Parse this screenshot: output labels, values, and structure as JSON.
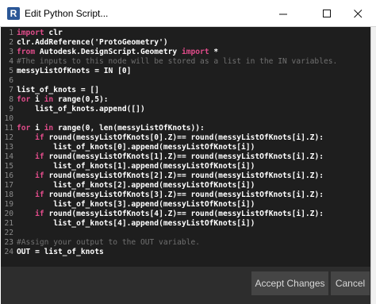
{
  "window": {
    "title": "Edit Python Script...",
    "app_icon_letter": "R",
    "controls": {
      "minimize": "minimize",
      "maximize": "maximize",
      "close": "close"
    }
  },
  "editor": {
    "lines": [
      {
        "n": "1",
        "segs": [
          [
            "kw",
            "import"
          ],
          [
            "tx",
            " clr"
          ]
        ]
      },
      {
        "n": "2",
        "segs": [
          [
            "tx",
            "clr.AddReference("
          ],
          [
            "st",
            "'ProtoGeometry'"
          ],
          [
            "tx",
            ")"
          ]
        ]
      },
      {
        "n": "3",
        "segs": [
          [
            "kw",
            "from"
          ],
          [
            "tx",
            " Autodesk.DesignScript.Geometry "
          ],
          [
            "kw",
            "import"
          ],
          [
            "tx",
            " *"
          ]
        ]
      },
      {
        "n": "4",
        "segs": [
          [
            "cm",
            "#The inputs to this node will be stored as a list in the IN variables."
          ]
        ]
      },
      {
        "n": "5",
        "segs": [
          [
            "tx",
            "messyListOfKnots = IN ["
          ],
          [
            "nu",
            "0"
          ],
          [
            "tx",
            "]"
          ]
        ]
      },
      {
        "n": "6",
        "segs": []
      },
      {
        "n": "7",
        "segs": [
          [
            "tx",
            "list_of_knots = []"
          ]
        ]
      },
      {
        "n": "8",
        "segs": [
          [
            "kw",
            "for"
          ],
          [
            "tx",
            " i "
          ],
          [
            "kw",
            "in"
          ],
          [
            "tx",
            " range("
          ],
          [
            "nu",
            "0"
          ],
          [
            "tx",
            ","
          ],
          [
            "nu",
            "5"
          ],
          [
            "tx",
            "):"
          ]
        ]
      },
      {
        "n": "9",
        "segs": [
          [
            "tx",
            "    list_of_knots.append([])"
          ]
        ]
      },
      {
        "n": "10",
        "segs": []
      },
      {
        "n": "11",
        "segs": [
          [
            "kw",
            "for"
          ],
          [
            "tx",
            " i "
          ],
          [
            "kw",
            "in"
          ],
          [
            "tx",
            " range("
          ],
          [
            "nu",
            "0"
          ],
          [
            "tx",
            ", len(messyListOfKnots)):"
          ]
        ]
      },
      {
        "n": "12",
        "segs": [
          [
            "tx",
            "    "
          ],
          [
            "kw",
            "if"
          ],
          [
            "tx",
            " round(messyListOfKnots["
          ],
          [
            "nu",
            "0"
          ],
          [
            "tx",
            "].Z)== round(messyListOfKnots[i].Z):"
          ]
        ]
      },
      {
        "n": "13",
        "segs": [
          [
            "tx",
            "        list_of_knots["
          ],
          [
            "nu",
            "0"
          ],
          [
            "tx",
            "].append(messyListOfKnots[i])"
          ]
        ]
      },
      {
        "n": "14",
        "segs": [
          [
            "tx",
            "    "
          ],
          [
            "kw",
            "if"
          ],
          [
            "tx",
            " round(messyListOfKnots["
          ],
          [
            "nu",
            "1"
          ],
          [
            "tx",
            "].Z)== round(messyListOfKnots[i].Z):"
          ]
        ]
      },
      {
        "n": "15",
        "segs": [
          [
            "tx",
            "        list_of_knots["
          ],
          [
            "nu",
            "1"
          ],
          [
            "tx",
            "].append(messyListOfKnots[i])"
          ]
        ]
      },
      {
        "n": "16",
        "segs": [
          [
            "tx",
            "    "
          ],
          [
            "kw",
            "if"
          ],
          [
            "tx",
            " round(messyListOfKnots["
          ],
          [
            "nu",
            "2"
          ],
          [
            "tx",
            "].Z)== round(messyListOfKnots[i].Z):"
          ]
        ]
      },
      {
        "n": "17",
        "segs": [
          [
            "tx",
            "        list_of_knots["
          ],
          [
            "nu",
            "2"
          ],
          [
            "tx",
            "].append(messyListOfKnots[i])"
          ]
        ]
      },
      {
        "n": "18",
        "segs": [
          [
            "tx",
            "    "
          ],
          [
            "kw",
            "if"
          ],
          [
            "tx",
            " round(messyListOfKnots["
          ],
          [
            "nu",
            "3"
          ],
          [
            "tx",
            "].Z)== round(messyListOfKnots[i].Z):"
          ]
        ]
      },
      {
        "n": "19",
        "segs": [
          [
            "tx",
            "        list_of_knots["
          ],
          [
            "nu",
            "3"
          ],
          [
            "tx",
            "].append(messyListOfKnots[i])"
          ]
        ]
      },
      {
        "n": "20",
        "segs": [
          [
            "tx",
            "    "
          ],
          [
            "kw",
            "if"
          ],
          [
            "tx",
            " round(messyListOfKnots["
          ],
          [
            "nu",
            "4"
          ],
          [
            "tx",
            "].Z)== round(messyListOfKnots[i].Z):"
          ]
        ]
      },
      {
        "n": "21",
        "segs": [
          [
            "tx",
            "        list_of_knots["
          ],
          [
            "nu",
            "4"
          ],
          [
            "tx",
            "].append(messyListOfKnots[i])"
          ]
        ]
      },
      {
        "n": "22",
        "segs": []
      },
      {
        "n": "23",
        "segs": [
          [
            "cm",
            "#Assign your output to the OUT variable."
          ]
        ]
      },
      {
        "n": "24",
        "segs": [
          [
            "tx",
            "OUT = list_of_knots"
          ]
        ]
      }
    ]
  },
  "footer": {
    "accept_label": "Accept Changes",
    "cancel_label": "Cancel"
  },
  "colors": {
    "editor_bg": "#1e1e1e",
    "keyword": "#e04c8a",
    "comment": "#707070",
    "footer_bg": "#2d2d2d",
    "button_bg": "#454545"
  }
}
